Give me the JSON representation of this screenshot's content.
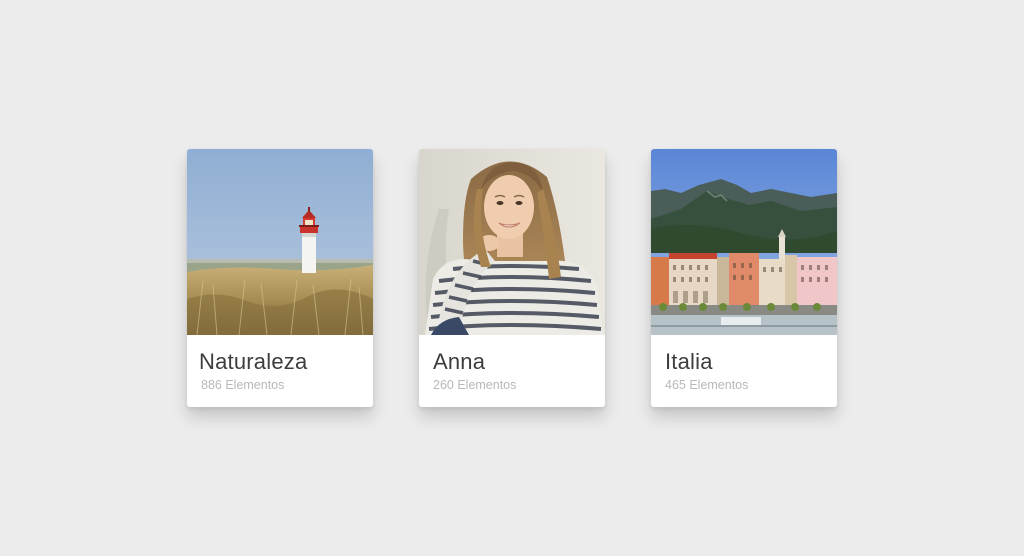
{
  "collections": [
    {
      "title": "Naturaleza",
      "count": "886 Elementos",
      "photo": "lighthouse-photo"
    },
    {
      "title": "Anna",
      "count": "260 Elementos",
      "photo": "portrait-photo"
    },
    {
      "title": "Italia",
      "count": "465 Elementos",
      "photo": "italian-town-photo"
    }
  ],
  "colors": {
    "background": "#ececec",
    "card": "#ffffff",
    "title_text": "#3d3d3d",
    "count_text": "#b8b8b8"
  }
}
